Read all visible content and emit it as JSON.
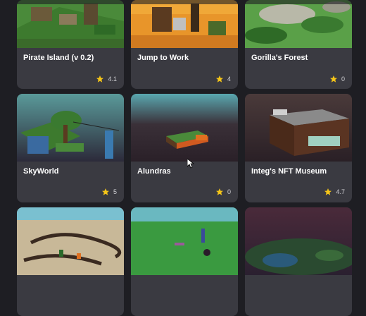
{
  "cards": [
    {
      "title": "Pirate Island (v 0.2)",
      "rating": "4.1",
      "thumb": "pirate-island-thumbnail"
    },
    {
      "title": "Jump to Work",
      "rating": "4",
      "thumb": "jump-to-work-thumbnail"
    },
    {
      "title": "Gorilla's Forest",
      "rating": "0",
      "thumb": "gorillas-forest-thumbnail"
    },
    {
      "title": "SkyWorld",
      "rating": "5",
      "thumb": "skyworld-thumbnail"
    },
    {
      "title": "Alundras",
      "rating": "0",
      "thumb": "alundras-thumbnail"
    },
    {
      "title": "Integ's NFT Museum",
      "rating": "4.7",
      "thumb": "nft-museum-thumbnail"
    },
    {
      "title": "",
      "rating": "",
      "thumb": "desert-maze-thumbnail"
    },
    {
      "title": "",
      "rating": "",
      "thumb": "green-field-thumbnail"
    },
    {
      "title": "",
      "rating": "",
      "thumb": "night-island-thumbnail"
    }
  ],
  "icons": {
    "rating": "star-icon",
    "pointer": "mouse-cursor-icon"
  },
  "colors": {
    "background": "#1e1e23",
    "card": "#3a3a41",
    "star": "#f5c518"
  }
}
